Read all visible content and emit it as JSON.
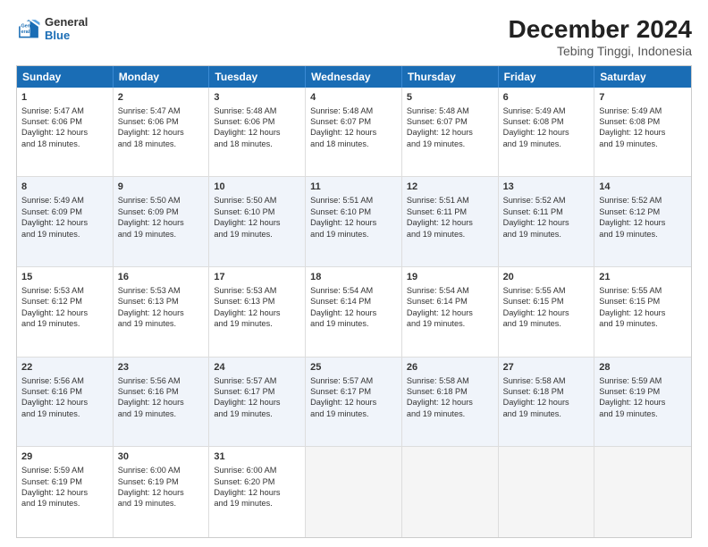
{
  "logo": {
    "line1": "General",
    "line2": "Blue"
  },
  "header": {
    "title": "December 2024",
    "subtitle": "Tebing Tinggi, Indonesia"
  },
  "weekdays": [
    "Sunday",
    "Monday",
    "Tuesday",
    "Wednesday",
    "Thursday",
    "Friday",
    "Saturday"
  ],
  "weeks": [
    [
      {
        "day": "1",
        "lines": [
          "Sunrise: 5:47 AM",
          "Sunset: 6:06 PM",
          "Daylight: 12 hours",
          "and 18 minutes."
        ]
      },
      {
        "day": "2",
        "lines": [
          "Sunrise: 5:47 AM",
          "Sunset: 6:06 PM",
          "Daylight: 12 hours",
          "and 18 minutes."
        ]
      },
      {
        "day": "3",
        "lines": [
          "Sunrise: 5:48 AM",
          "Sunset: 6:06 PM",
          "Daylight: 12 hours",
          "and 18 minutes."
        ]
      },
      {
        "day": "4",
        "lines": [
          "Sunrise: 5:48 AM",
          "Sunset: 6:07 PM",
          "Daylight: 12 hours",
          "and 18 minutes."
        ]
      },
      {
        "day": "5",
        "lines": [
          "Sunrise: 5:48 AM",
          "Sunset: 6:07 PM",
          "Daylight: 12 hours",
          "and 19 minutes."
        ]
      },
      {
        "day": "6",
        "lines": [
          "Sunrise: 5:49 AM",
          "Sunset: 6:08 PM",
          "Daylight: 12 hours",
          "and 19 minutes."
        ]
      },
      {
        "day": "7",
        "lines": [
          "Sunrise: 5:49 AM",
          "Sunset: 6:08 PM",
          "Daylight: 12 hours",
          "and 19 minutes."
        ]
      }
    ],
    [
      {
        "day": "8",
        "lines": [
          "Sunrise: 5:49 AM",
          "Sunset: 6:09 PM",
          "Daylight: 12 hours",
          "and 19 minutes."
        ]
      },
      {
        "day": "9",
        "lines": [
          "Sunrise: 5:50 AM",
          "Sunset: 6:09 PM",
          "Daylight: 12 hours",
          "and 19 minutes."
        ]
      },
      {
        "day": "10",
        "lines": [
          "Sunrise: 5:50 AM",
          "Sunset: 6:10 PM",
          "Daylight: 12 hours",
          "and 19 minutes."
        ]
      },
      {
        "day": "11",
        "lines": [
          "Sunrise: 5:51 AM",
          "Sunset: 6:10 PM",
          "Daylight: 12 hours",
          "and 19 minutes."
        ]
      },
      {
        "day": "12",
        "lines": [
          "Sunrise: 5:51 AM",
          "Sunset: 6:11 PM",
          "Daylight: 12 hours",
          "and 19 minutes."
        ]
      },
      {
        "day": "13",
        "lines": [
          "Sunrise: 5:52 AM",
          "Sunset: 6:11 PM",
          "Daylight: 12 hours",
          "and 19 minutes."
        ]
      },
      {
        "day": "14",
        "lines": [
          "Sunrise: 5:52 AM",
          "Sunset: 6:12 PM",
          "Daylight: 12 hours",
          "and 19 minutes."
        ]
      }
    ],
    [
      {
        "day": "15",
        "lines": [
          "Sunrise: 5:53 AM",
          "Sunset: 6:12 PM",
          "Daylight: 12 hours",
          "and 19 minutes."
        ]
      },
      {
        "day": "16",
        "lines": [
          "Sunrise: 5:53 AM",
          "Sunset: 6:13 PM",
          "Daylight: 12 hours",
          "and 19 minutes."
        ]
      },
      {
        "day": "17",
        "lines": [
          "Sunrise: 5:53 AM",
          "Sunset: 6:13 PM",
          "Daylight: 12 hours",
          "and 19 minutes."
        ]
      },
      {
        "day": "18",
        "lines": [
          "Sunrise: 5:54 AM",
          "Sunset: 6:14 PM",
          "Daylight: 12 hours",
          "and 19 minutes."
        ]
      },
      {
        "day": "19",
        "lines": [
          "Sunrise: 5:54 AM",
          "Sunset: 6:14 PM",
          "Daylight: 12 hours",
          "and 19 minutes."
        ]
      },
      {
        "day": "20",
        "lines": [
          "Sunrise: 5:55 AM",
          "Sunset: 6:15 PM",
          "Daylight: 12 hours",
          "and 19 minutes."
        ]
      },
      {
        "day": "21",
        "lines": [
          "Sunrise: 5:55 AM",
          "Sunset: 6:15 PM",
          "Daylight: 12 hours",
          "and 19 minutes."
        ]
      }
    ],
    [
      {
        "day": "22",
        "lines": [
          "Sunrise: 5:56 AM",
          "Sunset: 6:16 PM",
          "Daylight: 12 hours",
          "and 19 minutes."
        ]
      },
      {
        "day": "23",
        "lines": [
          "Sunrise: 5:56 AM",
          "Sunset: 6:16 PM",
          "Daylight: 12 hours",
          "and 19 minutes."
        ]
      },
      {
        "day": "24",
        "lines": [
          "Sunrise: 5:57 AM",
          "Sunset: 6:17 PM",
          "Daylight: 12 hours",
          "and 19 minutes."
        ]
      },
      {
        "day": "25",
        "lines": [
          "Sunrise: 5:57 AM",
          "Sunset: 6:17 PM",
          "Daylight: 12 hours",
          "and 19 minutes."
        ]
      },
      {
        "day": "26",
        "lines": [
          "Sunrise: 5:58 AM",
          "Sunset: 6:18 PM",
          "Daylight: 12 hours",
          "and 19 minutes."
        ]
      },
      {
        "day": "27",
        "lines": [
          "Sunrise: 5:58 AM",
          "Sunset: 6:18 PM",
          "Daylight: 12 hours",
          "and 19 minutes."
        ]
      },
      {
        "day": "28",
        "lines": [
          "Sunrise: 5:59 AM",
          "Sunset: 6:19 PM",
          "Daylight: 12 hours",
          "and 19 minutes."
        ]
      }
    ],
    [
      {
        "day": "29",
        "lines": [
          "Sunrise: 5:59 AM",
          "Sunset: 6:19 PM",
          "Daylight: 12 hours",
          "and 19 minutes."
        ]
      },
      {
        "day": "30",
        "lines": [
          "Sunrise: 6:00 AM",
          "Sunset: 6:19 PM",
          "Daylight: 12 hours",
          "and 19 minutes."
        ]
      },
      {
        "day": "31",
        "lines": [
          "Sunrise: 6:00 AM",
          "Sunset: 6:20 PM",
          "Daylight: 12 hours",
          "and 19 minutes."
        ]
      },
      {
        "day": "",
        "lines": []
      },
      {
        "day": "",
        "lines": []
      },
      {
        "day": "",
        "lines": []
      },
      {
        "day": "",
        "lines": []
      }
    ]
  ]
}
